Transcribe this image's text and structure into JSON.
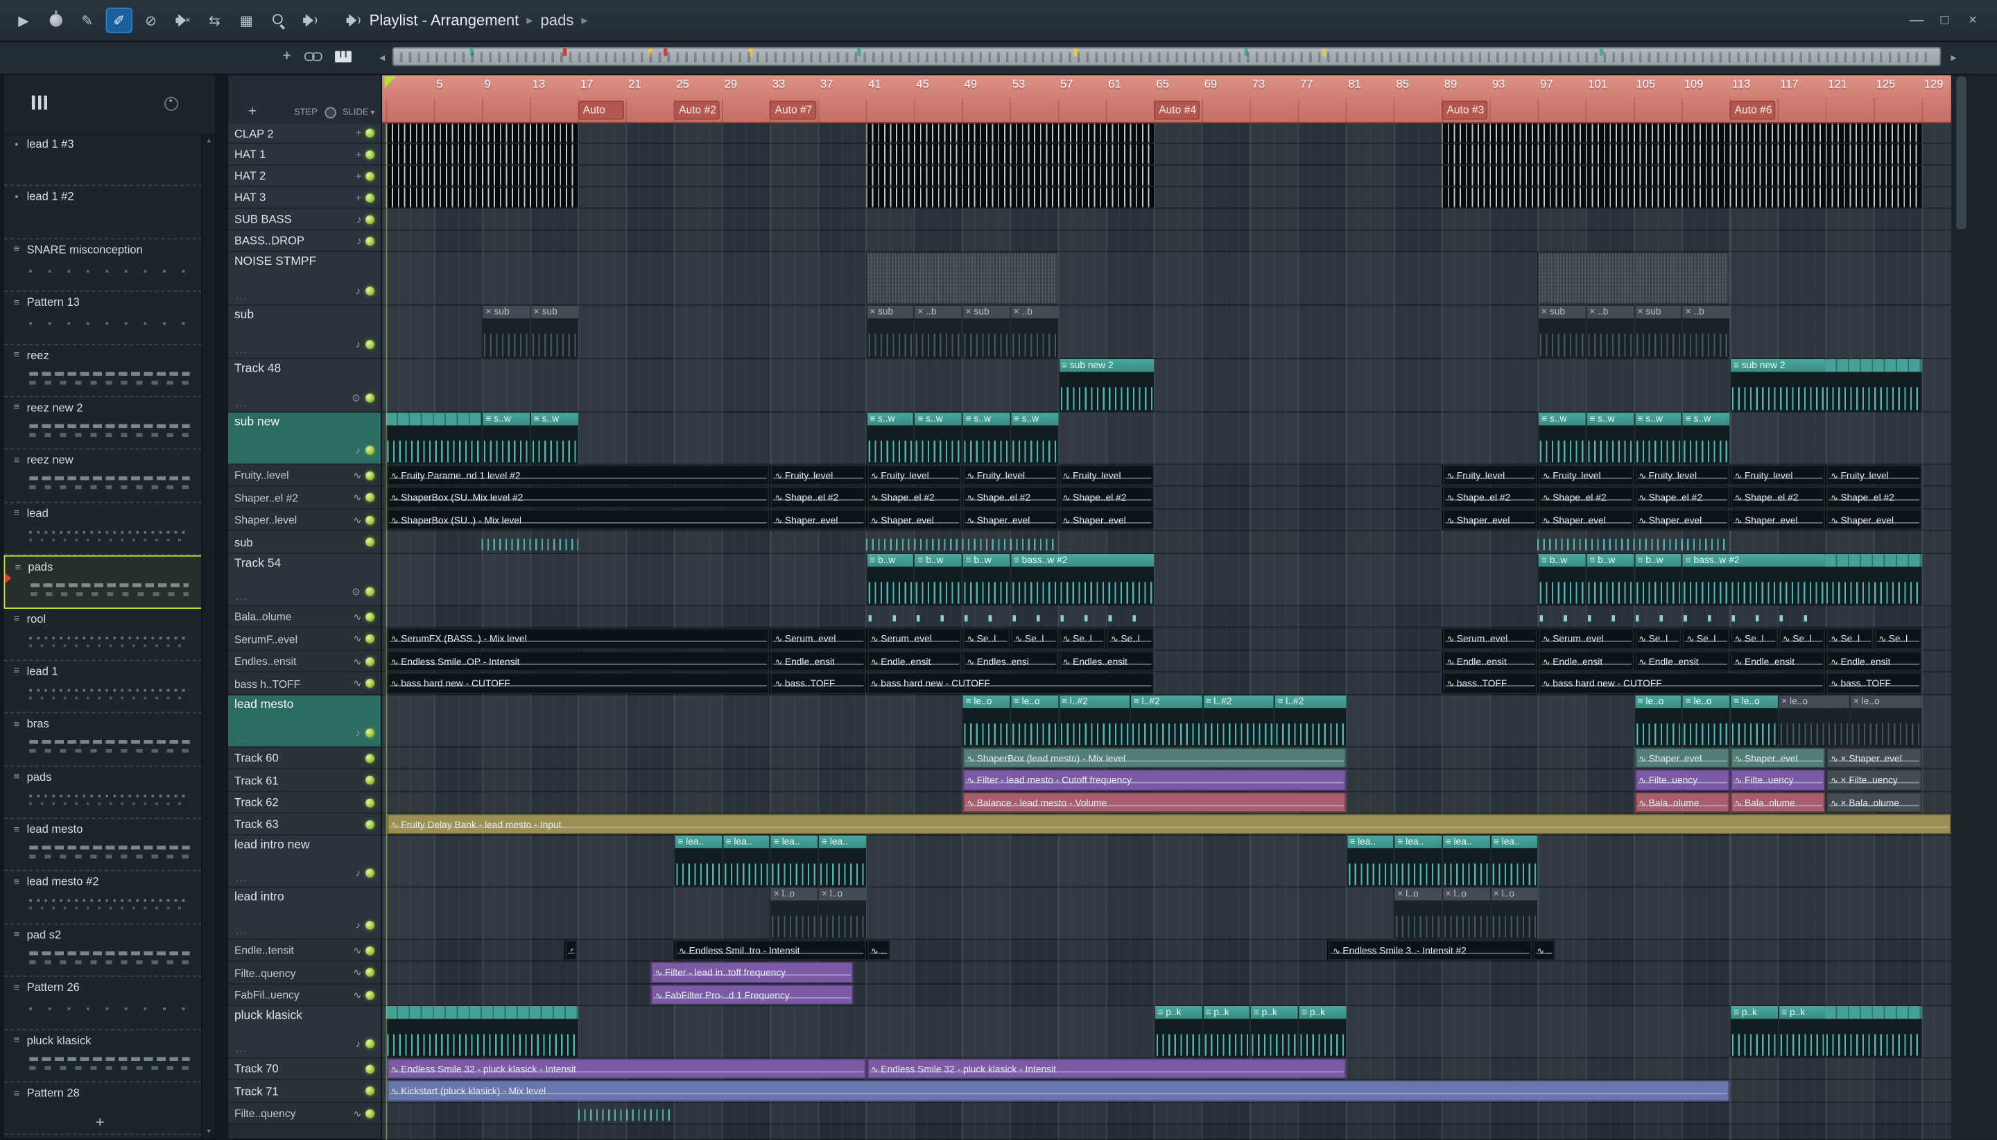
{
  "app": {
    "title": "Playlist - Arrangement",
    "crumb": "pads",
    "sep": "▸",
    "win_min": "—",
    "win_max": "□",
    "win_close": "×"
  },
  "toolbar": {
    "glyphs": {
      "play": "▶",
      "draw": "✎",
      "paint": "✐",
      "erase": "⊘",
      "slip": "⇆",
      "select": "▦"
    }
  },
  "corner": {
    "scroll_left": "◂",
    "scroll_right": "▸"
  },
  "trackpanel": {
    "add": "+",
    "step": "STEP",
    "slide": "SLIDE",
    "caret": "▾"
  },
  "picker": {
    "plus": "+",
    "scroll_up": "▴",
    "scroll_down": "▾",
    "items": [
      {
        "label": "lead 1 #3",
        "icon": "audio",
        "preview": "none"
      },
      {
        "label": "lead 1 #2",
        "icon": "audio",
        "preview": "none"
      },
      {
        "label": "SNARE misconception",
        "icon": "pattern",
        "preview": "sparse"
      },
      {
        "label": "Pattern 13",
        "icon": "pattern",
        "preview": "sparse"
      },
      {
        "label": "reez",
        "icon": "pattern",
        "preview": "bars"
      },
      {
        "label": "reez new 2",
        "icon": "pattern",
        "preview": "bars"
      },
      {
        "label": "reez new",
        "icon": "pattern",
        "preview": "bars"
      },
      {
        "label": "lead",
        "icon": "pattern",
        "preview": "dots"
      },
      {
        "label": "pads",
        "icon": "pattern",
        "preview": "bars",
        "selected": true
      },
      {
        "label": "rool",
        "icon": "pattern",
        "preview": "dots"
      },
      {
        "label": "lead 1",
        "icon": "pattern",
        "preview": "dots"
      },
      {
        "label": "bras",
        "icon": "pattern",
        "preview": "bars"
      },
      {
        "label": "pads",
        "icon": "pattern",
        "preview": "dots"
      },
      {
        "label": "lead mesto",
        "icon": "pattern",
        "preview": "bars"
      },
      {
        "label": "lead mesto #2",
        "icon": "pattern",
        "preview": "dots"
      },
      {
        "label": "pad s2",
        "icon": "pattern",
        "preview": "bars"
      },
      {
        "label": "Pattern 26",
        "icon": "pattern",
        "preview": "sparse"
      },
      {
        "label": "pluck klasick",
        "icon": "pattern",
        "preview": "bars"
      },
      {
        "label": "Pattern 28",
        "icon": "pattern",
        "preview": "none"
      }
    ]
  },
  "lanes": [
    {
      "name": "CLAP 2",
      "h": 16,
      "kind": "step"
    },
    {
      "name": "HAT 1",
      "h": 17,
      "kind": "step"
    },
    {
      "name": "HAT 2",
      "h": 17,
      "kind": "step"
    },
    {
      "name": "HAT 3",
      "h": 17,
      "kind": "step"
    },
    {
      "name": "SUB BASS",
      "h": 17,
      "kind": "note"
    },
    {
      "name": "BASS..DROP",
      "h": 17,
      "kind": "note"
    },
    {
      "name": "NOISE STMPF",
      "h": 42,
      "kind": "group"
    },
    {
      "name": "sub",
      "h": 42,
      "kind": "group"
    },
    {
      "name": "Track 48",
      "h": 42,
      "kind": "groupdot"
    },
    {
      "name": "sub new",
      "h": 41,
      "kind": "groupteal"
    },
    {
      "name": "Fruity..level",
      "h": 17,
      "kind": "auto"
    },
    {
      "name": "Shaper..el #2",
      "h": 18,
      "kind": "auto"
    },
    {
      "name": "Shaper..level",
      "h": 17,
      "kind": "auto"
    },
    {
      "name": "sub",
      "h": 18,
      "kind": "plain"
    },
    {
      "name": "Track 54",
      "h": 41,
      "kind": "groupdot"
    },
    {
      "name": "Bala..olume",
      "h": 17,
      "kind": "auto"
    },
    {
      "name": "SerumF..evel",
      "h": 18,
      "kind": "auto"
    },
    {
      "name": "Endles..ensit",
      "h": 17,
      "kind": "auto"
    },
    {
      "name": "bass h..TOFF",
      "h": 18,
      "kind": "auto"
    },
    {
      "name": "lead mesto",
      "h": 41,
      "kind": "groupteal"
    },
    {
      "name": "Track 60",
      "h": 17,
      "kind": "plain"
    },
    {
      "name": "Track 61",
      "h": 18,
      "kind": "plain"
    },
    {
      "name": "Track 62",
      "h": 17,
      "kind": "plain"
    },
    {
      "name": "Track 63",
      "h": 17,
      "kind": "plain"
    },
    {
      "name": "lead intro new",
      "h": 41,
      "kind": "group"
    },
    {
      "name": "lead intro",
      "h": 41,
      "kind": "group"
    },
    {
      "name": "Endle..tensit",
      "h": 17,
      "kind": "auto"
    },
    {
      "name": "Filte..quency",
      "h": 18,
      "kind": "auto"
    },
    {
      "name": "FabFil..uency",
      "h": 17,
      "kind": "auto"
    },
    {
      "name": "pluck klasick",
      "h": 41,
      "kind": "group"
    },
    {
      "name": "Track 70",
      "h": 17,
      "kind": "plain"
    },
    {
      "name": "Track 71",
      "h": 18,
      "kind": "plain"
    },
    {
      "name": "Filte..quency",
      "h": 17,
      "kind": "auto"
    },
    {
      "name": "",
      "h": 12,
      "kind": "blank"
    }
  ],
  "timeline": {
    "bars": [
      5,
      9,
      13,
      17,
      21,
      25,
      29,
      33,
      37,
      41,
      45,
      49,
      53,
      57,
      61,
      65,
      69,
      73,
      77,
      81,
      85,
      89,
      93,
      97,
      101,
      105,
      109,
      113,
      117,
      121,
      125,
      129
    ],
    "auto_markers": [
      {
        "label": "Auto",
        "bar": 17
      },
      {
        "label": "Auto #2",
        "bar": 25
      },
      {
        "label": "Auto #7",
        "bar": 33
      },
      {
        "label": "Auto #4",
        "bar": 65
      },
      {
        "label": "Auto #3",
        "bar": 89
      },
      {
        "label": "Auto #6",
        "bar": 113
      }
    ]
  },
  "overview": {
    "marks": [
      {
        "p": 0.05,
        "c": "#4aa89d"
      },
      {
        "p": 0.11,
        "c": "#c0463c"
      },
      {
        "p": 0.165,
        "c": "#e8c84a"
      },
      {
        "p": 0.175,
        "c": "#c0463c"
      },
      {
        "p": 0.23,
        "c": "#e8c84a"
      },
      {
        "p": 0.3,
        "c": "#4aa89d"
      },
      {
        "p": 0.44,
        "c": "#e8c84a"
      },
      {
        "p": 0.55,
        "c": "#4aa89d"
      },
      {
        "p": 0.6,
        "c": "#e8c84a"
      },
      {
        "p": 0.78,
        "c": "#4aa89d"
      }
    ]
  },
  "clips": [
    [
      0,
      1,
      16,
      "step"
    ],
    [
      1,
      1,
      16,
      "step"
    ],
    [
      2,
      1,
      16,
      "step"
    ],
    [
      3,
      1,
      16,
      "step"
    ],
    [
      0,
      41,
      24,
      "step"
    ],
    [
      1,
      41,
      24,
      "step"
    ],
    [
      2,
      41,
      24,
      "step"
    ],
    [
      3,
      41,
      24,
      "step"
    ],
    [
      0,
      89,
      40,
      "step"
    ],
    [
      1,
      89,
      40,
      "step"
    ],
    [
      2,
      89,
      40,
      "step"
    ],
    [
      3,
      89,
      40,
      "step"
    ],
    [
      6,
      41,
      16,
      "noise"
    ],
    [
      6,
      97,
      16,
      "noise"
    ],
    [
      7,
      9,
      4,
      "mp",
      "× sub"
    ],
    [
      7,
      13,
      4,
      "mp",
      "× sub"
    ],
    [
      7,
      41,
      4,
      "mp",
      "× sub"
    ],
    [
      7,
      45,
      4,
      "mp",
      "× ..b"
    ],
    [
      7,
      49,
      4,
      "mp",
      "× sub"
    ],
    [
      7,
      53,
      4,
      "mp",
      "× ..b"
    ],
    [
      7,
      97,
      4,
      "mp",
      "× sub"
    ],
    [
      7,
      101,
      4,
      "mp",
      "× ..b"
    ],
    [
      7,
      105,
      4,
      "mp",
      "× sub"
    ],
    [
      7,
      109,
      4,
      "mp",
      "× ..b"
    ],
    [
      8,
      57,
      8,
      "pat",
      "sub new 2"
    ],
    [
      8,
      113,
      8,
      "pat",
      "sub new 2"
    ],
    [
      8,
      121,
      8,
      "strip"
    ],
    [
      9,
      1,
      8,
      "strip"
    ],
    [
      9,
      9,
      4,
      "pat",
      "s..w"
    ],
    [
      9,
      13,
      4,
      "pat",
      "s..w"
    ],
    [
      9,
      41,
      4,
      "pat",
      "s..w"
    ],
    [
      9,
      45,
      4,
      "pat",
      "s..w"
    ],
    [
      9,
      49,
      4,
      "pat",
      "s..w"
    ],
    [
      9,
      53,
      4,
      "pat",
      "s..w"
    ],
    [
      9,
      97,
      4,
      "pat",
      "s..w"
    ],
    [
      9,
      101,
      4,
      "pat",
      "s..w"
    ],
    [
      9,
      105,
      4,
      "pat",
      "s..w"
    ],
    [
      9,
      109,
      4,
      "pat",
      "s..w"
    ],
    [
      10,
      1,
      32,
      "aut",
      "Fruity Parame..nd 1 level #2"
    ],
    [
      10,
      33,
      8,
      "aut",
      "Fruity..level"
    ],
    [
      10,
      41,
      8,
      "aut",
      "Fruity..level"
    ],
    [
      10,
      49,
      8,
      "aut",
      "Fruity..level"
    ],
    [
      10,
      57,
      8,
      "aut",
      "Fruity..level"
    ],
    [
      10,
      89,
      8,
      "aut",
      "Fruity..level"
    ],
    [
      10,
      97,
      8,
      "aut",
      "Fruity..level"
    ],
    [
      10,
      105,
      8,
      "aut",
      "Fruity..level"
    ],
    [
      10,
      113,
      8,
      "aut",
      "Fruity..level"
    ],
    [
      10,
      121,
      8,
      "aut",
      "Fruity..level"
    ],
    [
      11,
      1,
      32,
      "aut",
      "ShaperBox (SU..Mix level #2"
    ],
    [
      11,
      33,
      8,
      "aut",
      "Shape..el #2"
    ],
    [
      11,
      41,
      8,
      "aut",
      "Shape..el #2"
    ],
    [
      11,
      49,
      8,
      "aut",
      "Shape..el #2"
    ],
    [
      11,
      57,
      8,
      "aut",
      "Shape..el #2"
    ],
    [
      11,
      89,
      8,
      "aut",
      "Shape..el #2"
    ],
    [
      11,
      97,
      8,
      "aut",
      "Shape..el #2"
    ],
    [
      11,
      105,
      8,
      "aut",
      "Shape..el #2"
    ],
    [
      11,
      113,
      8,
      "aut",
      "Shape..el #2"
    ],
    [
      11,
      121,
      8,
      "aut",
      "Shape..el #2"
    ],
    [
      12,
      1,
      32,
      "aut",
      "ShaperBox (SU..) - Mix level"
    ],
    [
      12,
      33,
      8,
      "aut",
      "Shaper..evel"
    ],
    [
      12,
      41,
      8,
      "aut",
      "Shaper..evel"
    ],
    [
      12,
      49,
      8,
      "aut",
      "Shaper..evel"
    ],
    [
      12,
      57,
      8,
      "aut",
      "Shaper..evel"
    ],
    [
      12,
      89,
      8,
      "aut",
      "Shaper..evel"
    ],
    [
      12,
      97,
      8,
      "aut",
      "Shaper..evel"
    ],
    [
      12,
      105,
      8,
      "aut",
      "Shaper..evel"
    ],
    [
      12,
      113,
      8,
      "aut",
      "Shaper..evel"
    ],
    [
      12,
      121,
      8,
      "aut",
      "Shaper..evel"
    ],
    [
      13,
      9,
      8,
      "ticks"
    ],
    [
      13,
      41,
      16,
      "ticks"
    ],
    [
      13,
      97,
      16,
      "ticks"
    ],
    [
      14,
      41,
      4,
      "pat",
      "b..w"
    ],
    [
      14,
      45,
      4,
      "pat",
      "b..w"
    ],
    [
      14,
      49,
      4,
      "pat",
      "b..w"
    ],
    [
      14,
      53,
      12,
      "pat",
      "bass..w #2"
    ],
    [
      14,
      97,
      4,
      "pat",
      "b..w"
    ],
    [
      14,
      101,
      4,
      "pat",
      "b..w"
    ],
    [
      14,
      105,
      4,
      "pat",
      "b..w"
    ],
    [
      14,
      109,
      12,
      "pat",
      "bass..w #2"
    ],
    [
      14,
      121,
      8,
      "strip"
    ],
    [
      15,
      41,
      24,
      "blips"
    ],
    [
      15,
      97,
      24,
      "blips"
    ],
    [
      16,
      1,
      32,
      "aut",
      "SerumFX (BASS..) - Mix level"
    ],
    [
      16,
      33,
      8,
      "aut",
      "Serum..evel"
    ],
    [
      16,
      41,
      8,
      "aut",
      "Serum..evel"
    ],
    [
      16,
      49,
      4,
      "aut",
      "Se..l"
    ],
    [
      16,
      53,
      4,
      "aut",
      "Se..l"
    ],
    [
      16,
      57,
      4,
      "aut",
      "Se..l"
    ],
    [
      16,
      61,
      4,
      "aut",
      "Se..l"
    ],
    [
      16,
      89,
      8,
      "aut",
      "Serum..evel"
    ],
    [
      16,
      97,
      8,
      "aut",
      "Serum..evel"
    ],
    [
      16,
      105,
      4,
      "aut",
      "Se..l"
    ],
    [
      16,
      109,
      4,
      "aut",
      "Se..l"
    ],
    [
      16,
      113,
      4,
      "aut",
      "Se..l"
    ],
    [
      16,
      117,
      4,
      "aut",
      "Se..l"
    ],
    [
      16,
      121,
      4,
      "aut",
      "Se..l"
    ],
    [
      16,
      125,
      4,
      "aut",
      "Se..l"
    ],
    [
      17,
      1,
      32,
      "aut",
      "Endless Smile..OP - Intensit"
    ],
    [
      17,
      33,
      8,
      "aut",
      "Endle..ensit"
    ],
    [
      17,
      41,
      8,
      "aut",
      "Endle..ensit"
    ],
    [
      17,
      49,
      8,
      "aut",
      "Endles..ensi"
    ],
    [
      17,
      57,
      8,
      "aut",
      "Endles..ensit"
    ],
    [
      17,
      89,
      8,
      "aut",
      "Endle..ensit"
    ],
    [
      17,
      97,
      8,
      "aut",
      "Endle..ensit"
    ],
    [
      17,
      105,
      8,
      "aut",
      "Endle..ensit"
    ],
    [
      17,
      113,
      8,
      "aut",
      "Endle..ensit"
    ],
    [
      17,
      121,
      8,
      "aut",
      "Endle..ensit"
    ],
    [
      18,
      1,
      32,
      "aut",
      "bass hard new - CUTOFF"
    ],
    [
      18,
      33,
      8,
      "aut",
      "bass..TOFF"
    ],
    [
      18,
      41,
      24,
      "aut",
      "bass hard new - CUTOFF"
    ],
    [
      18,
      89,
      8,
      "aut",
      "bass..TOFF"
    ],
    [
      18,
      97,
      24,
      "aut",
      "bass hard new - CUTOFF"
    ],
    [
      18,
      121,
      8,
      "aut",
      "bass..TOFF"
    ],
    [
      19,
      49,
      4,
      "pat",
      "le..o"
    ],
    [
      19,
      53,
      4,
      "pat",
      "le..o"
    ],
    [
      19,
      57,
      6,
      "pat",
      "l..#2"
    ],
    [
      19,
      63,
      6,
      "pat",
      "l..#2"
    ],
    [
      19,
      69,
      6,
      "pat",
      "l..#2"
    ],
    [
      19,
      75,
      6,
      "pat",
      "l..#2"
    ],
    [
      19,
      105,
      4,
      "pat",
      "le..o"
    ],
    [
      19,
      109,
      4,
      "pat",
      "le..o"
    ],
    [
      19,
      113,
      4,
      "pat",
      "le..o"
    ],
    [
      19,
      117,
      6,
      "mp",
      "× le..o"
    ],
    [
      19,
      123,
      6,
      "mp",
      "× le..o"
    ],
    [
      20,
      49,
      32,
      "ateal",
      "ShaperBox (lead mesto) - Mix level"
    ],
    [
      20,
      105,
      8,
      "ateal",
      "Shaper..evel"
    ],
    [
      20,
      113,
      8,
      "ateal",
      "Shaper..evel"
    ],
    [
      20,
      121,
      8,
      "maut",
      "× Shaper..evel"
    ],
    [
      21,
      49,
      32,
      "apurp",
      "Filter - lead mesto - Cutoff frequency"
    ],
    [
      21,
      105,
      8,
      "apurp",
      "Filte..uency"
    ],
    [
      21,
      113,
      8,
      "apurp",
      "Filte..uency"
    ],
    [
      21,
      121,
      8,
      "maut",
      "× Filte..uency"
    ],
    [
      22,
      49,
      32,
      "apink",
      "Balance - lead mesto - Volume"
    ],
    [
      22,
      105,
      8,
      "apink",
      "Bala..olume"
    ],
    [
      22,
      113,
      8,
      "apink",
      "Bala..olume"
    ],
    [
      22,
      121,
      8,
      "maut",
      "× Bala..olume"
    ],
    [
      23,
      1,
      130.5,
      "aolive",
      "Fruity Delay Bank - lead mesto - Input"
    ],
    [
      24,
      25,
      4,
      "pat",
      "lea.."
    ],
    [
      24,
      29,
      4,
      "pat",
      "lea.."
    ],
    [
      24,
      33,
      4,
      "pat",
      "lea.."
    ],
    [
      24,
      37,
      4,
      "pat",
      "lea.."
    ],
    [
      24,
      81,
      4,
      "pat",
      "lea.."
    ],
    [
      24,
      85,
      4,
      "pat",
      "lea.."
    ],
    [
      24,
      89,
      4,
      "pat",
      "lea.."
    ],
    [
      24,
      93,
      4,
      "pat",
      "lea.."
    ],
    [
      25,
      33,
      4,
      "mp",
      "× l..o"
    ],
    [
      25,
      37,
      4,
      "mp",
      "× l..o"
    ],
    [
      25,
      85,
      4,
      "mp",
      "× l..o"
    ],
    [
      25,
      89,
      4,
      "mp",
      "× l..o"
    ],
    [
      25,
      93,
      4,
      "mp",
      "× l..o"
    ],
    [
      26,
      15.9,
      1,
      "aut",
      ""
    ],
    [
      26,
      25,
      16,
      "aut",
      "Endless Smil..tro - Intensit"
    ],
    [
      26,
      41,
      2,
      "aut",
      "..t"
    ],
    [
      26,
      79.5,
      17,
      "aut",
      "Endless Smile 3..- Intensit #2"
    ],
    [
      26,
      96.5,
      2,
      "aut",
      "..t"
    ],
    [
      27,
      23,
      17,
      "apurp",
      "Filter - lead in..toff frequency"
    ],
    [
      28,
      23,
      17,
      "apurp",
      "FabFilter Pro-..d 1 Frequency"
    ],
    [
      29,
      1,
      16,
      "strip"
    ],
    [
      29,
      65,
      4,
      "pat",
      "p..k"
    ],
    [
      29,
      69,
      4,
      "pat",
      "p..k"
    ],
    [
      29,
      73,
      4,
      "pat",
      "p..k"
    ],
    [
      29,
      77,
      4,
      "pat",
      "p..k"
    ],
    [
      29,
      113,
      4,
      "pat",
      "p..k"
    ],
    [
      29,
      117,
      4,
      "pat",
      "p..k"
    ],
    [
      29,
      121,
      8,
      "strip"
    ],
    [
      30,
      1,
      40,
      "apurp",
      "Endless Smile 32 - pluck klasick - Intensit"
    ],
    [
      30,
      41,
      40,
      "apurp",
      "Endless Smile 32 - pluck klasick - Intensit"
    ],
    [
      31,
      1,
      112,
      "ablue",
      "Kickstart (pluck klasick) - Mix level"
    ],
    [
      32,
      17,
      8,
      "ticks"
    ]
  ],
  "colors": {
    "teal": "#3f968c",
    "note": "#5ecfc2",
    "ruler": "#d4837b",
    "ruler_dark": "#b4584f",
    "purple": "#7c5ba6",
    "pink": "#a95e6d",
    "olive": "#9c8f54",
    "blue": "#6a76ac",
    "tealgray": "#547f78",
    "led": "#9ccc3c",
    "select_lime": "#cddc39",
    "tool_active": "#3f8fd4"
  }
}
